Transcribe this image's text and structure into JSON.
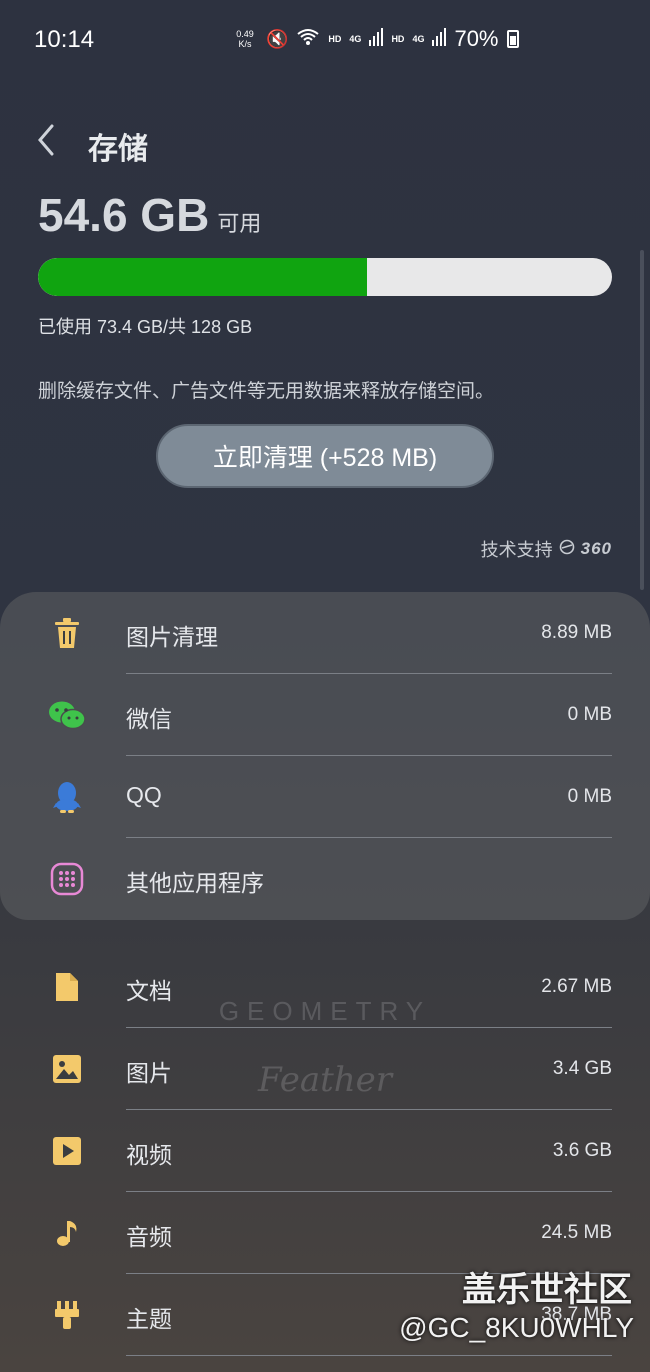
{
  "status_bar": {
    "time": "10:14",
    "net_speed_value": "0.49",
    "net_speed_unit": "K/s",
    "hd1": "HD",
    "net1": "4G",
    "hd2": "HD",
    "net2": "4G",
    "battery": "70%"
  },
  "header": {
    "back_icon": "back-arrow-icon",
    "title": "存储"
  },
  "storage": {
    "free_value": "54.6 GB",
    "free_unit": "可用",
    "used_fraction": 0.573,
    "used_text": "已使用 73.4 GB/共 128 GB",
    "description": "删除缓存文件、广告文件等无用数据来释放存储空间。",
    "clean_button": "立即清理 (+528 MB)",
    "tech_support": "技术支持",
    "tech_brand": "360"
  },
  "colors": {
    "used_bar": "#10a410",
    "icon_yellow": "#f3c96b",
    "wechat_green": "#3fc34b",
    "qq_blue": "#3b7bd8",
    "apps_pink": "#e889d6"
  },
  "cleanup_items": [
    {
      "icon": "trash-icon",
      "label": "图片清理",
      "value": "8.89 MB"
    },
    {
      "icon": "wechat-icon",
      "label": "微信",
      "value": "0 MB"
    },
    {
      "icon": "qq-icon",
      "label": "QQ",
      "value": "0 MB"
    },
    {
      "icon": "apps-grid-icon",
      "label": "其他应用程序",
      "value": ""
    }
  ],
  "categories": [
    {
      "icon": "document-icon",
      "label": "文档",
      "value": "2.67 MB"
    },
    {
      "icon": "image-icon",
      "label": "图片",
      "value": "3.4 GB"
    },
    {
      "icon": "video-icon",
      "label": "视频",
      "value": "3.6 GB"
    },
    {
      "icon": "music-note-icon",
      "label": "音频",
      "value": "24.5 MB"
    },
    {
      "icon": "brush-icon",
      "label": "主题",
      "value": "38.7 MB"
    }
  ],
  "watermarks": {
    "geometry": "GEOMETRY",
    "feather": "Feather",
    "forum": "盖乐世社区",
    "user": "@GC_8KU0WHLY"
  }
}
